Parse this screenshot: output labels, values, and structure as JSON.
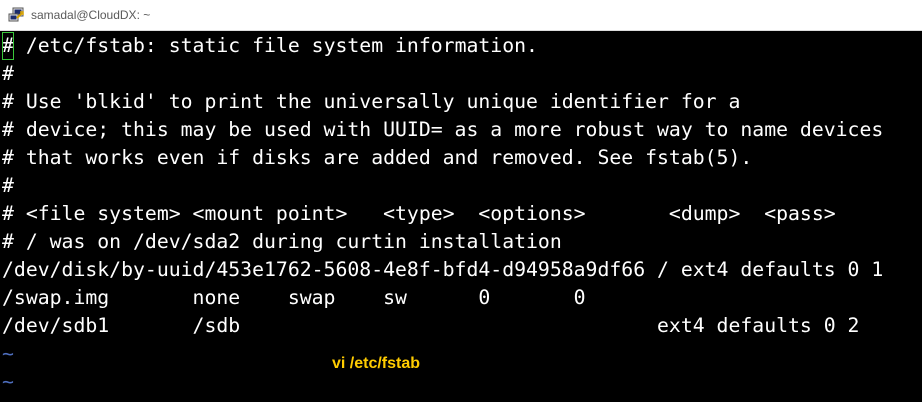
{
  "window": {
    "title": "samadal@CloudDX: ~",
    "icon": "putty-icon"
  },
  "terminal": {
    "cursor_char": "#",
    "first_line_rest": " /etc/fstab: static file system information.",
    "lines": [
      "#",
      "# Use 'blkid' to print the universally unique identifier for a",
      "# device; this may be used with UUID= as a more robust way to name devices",
      "# that works even if disks are added and removed. See fstab(5).",
      "#",
      "# <file system> <mount point>   <type>  <options>       <dump>  <pass>",
      "# / was on /dev/sda2 during curtin installation",
      "/dev/disk/by-uuid/453e1762-5608-4e8f-bfd4-d94958a9df66 / ext4 defaults 0 1",
      "/swap.img       none    swap    sw      0       0",
      "/dev/sdb1       /sdb                                   ext4 defaults 0 2"
    ],
    "tilde": "~",
    "cursor_color": "#39c639",
    "tilde_color": "#4f6fbf"
  },
  "annotation": {
    "text": "vi /etc/fstab",
    "color": "#ffcc00"
  }
}
